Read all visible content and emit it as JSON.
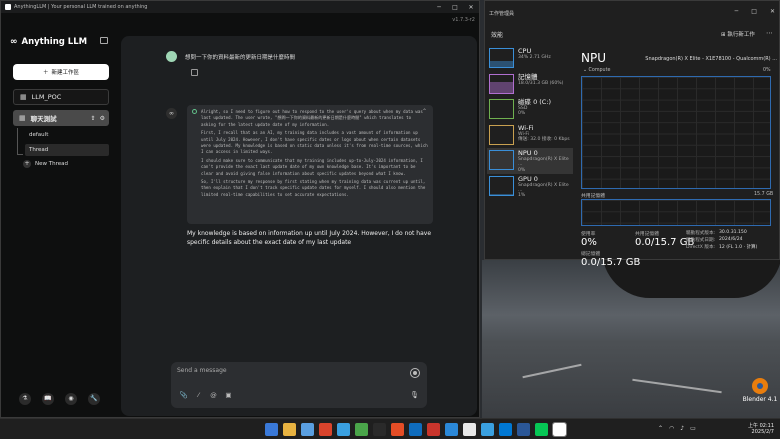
{
  "llm": {
    "window_title": "AnythingLLM | Your personal LLM trained on anything",
    "version": "v1.7.3-r2",
    "brand": "Anything LLM",
    "new_workspace": "新建工作區",
    "workspaces": [
      {
        "label": "LLM_POC"
      },
      {
        "label": "聊天測試"
      }
    ],
    "threads": [
      {
        "label": "default"
      },
      {
        "label": "Thread"
      }
    ],
    "new_thread": "New Thread",
    "user_message": "想問一下你的資料最新的更新日期是什麼時間",
    "thinking": [
      "Alright, so I need to figure out how to respond to the user's query about when my data was last updated. The user wrote, \"想問一下你的資料最新的更新日期是什麼時間\" which translates to asking for the latest update date of my information.",
      "First, I recall that as an AI, my training data includes a vast amount of information up until July 2024. However, I don't have specific dates or logs about when certain datasets were updated. My knowledge is based on static data unless it's from real-time sources, which I can access in limited ways.",
      "I should make sure to communicate that my training includes up-to-July-2024 information, I can't provide the exact last update date of my own knowledge base. It's important to be clear and avoid giving false information about specific updates beyond what I know.",
      "So, I'll structure my response by first stating when my training data was current up until, then explain that I don't track specific update dates for myself. I should also mention the limited real-time capabilities to set accurate expectations."
    ],
    "answer": "My knowledge is based on information up until July 2024. However, I do not have specific details about the exact date of my last update",
    "input_placeholder": "Send a message"
  },
  "taskmgr": {
    "title": "工作管理員",
    "section": "效能",
    "run_task": "執行新工作",
    "items": [
      {
        "name": "CPU",
        "sub1": "34%  2.71 GHz",
        "sub2": "",
        "color": "#3a8fd8",
        "level": 0.34
      },
      {
        "name": "記憶體",
        "sub1": "18.0/31.3 GB (60%)",
        "sub2": "",
        "color": "#b06fd0",
        "level": 0.6
      },
      {
        "name": "磁碟 0 (C:)",
        "sub1": "SSD",
        "sub2": "0%",
        "color": "#6fb04f",
        "level": 0.0
      },
      {
        "name": "Wi-Fi",
        "sub1": "Wi-Fi",
        "sub2": "傳送: 32.0  接收: 0 Kbps",
        "color": "#c8a050",
        "level": 0.0
      },
      {
        "name": "NPU 0",
        "sub1": "Snapdragon(R) X Elite ...",
        "sub2": "0%",
        "color": "#3a8fd8",
        "level": 0.0
      },
      {
        "name": "GPU 0",
        "sub1": "Snapdragon(R) X Elite ...",
        "sub2": "1%",
        "color": "#3a8fd8",
        "level": 0.01
      }
    ],
    "npu_title": "NPU",
    "npu_chip": "Snapdragon(R) X Elite - X1E78100 - Qualcomm(R) ...",
    "compute_label": "Compute",
    "compute_pct": "0%",
    "shared_mem_label": "共用記憶體",
    "shared_mem_max": "15.7 GB",
    "util_label": "使用率",
    "util_value": "0%",
    "shared_label": "共用記憶體",
    "shared_value": "0.0/15.7 GB",
    "total_label": "總記憶體",
    "total_value": "0.0/15.7 GB",
    "driver_version_label": "驅動程式版本:",
    "driver_version": "30.0.31.150",
    "driver_date_label": "驅動程式日期:",
    "driver_date": "2024/6/24",
    "directx_label": "DirectX 版本:",
    "directx": "12 (FL 1.0 · 計算)"
  },
  "desktop": {
    "icon_label": "Blender 4.1"
  },
  "taskbar": {
    "clock_time": "上午 02:11",
    "clock_date": "2025/2/7",
    "icons": [
      "#3a79d8",
      "#e8b341",
      "#5a9fe0",
      "#d9442c",
      "#3aa0e0",
      "#4aa54a",
      "#2a2a2a",
      "#e44d26",
      "#0f6cbd",
      "#c8352c",
      "#2b88d8",
      "#e8e8e8",
      "#3aa0e0",
      "#0078d4",
      "#2b5797",
      "#06c755",
      "#ffffff"
    ],
    "active_index": 16
  }
}
